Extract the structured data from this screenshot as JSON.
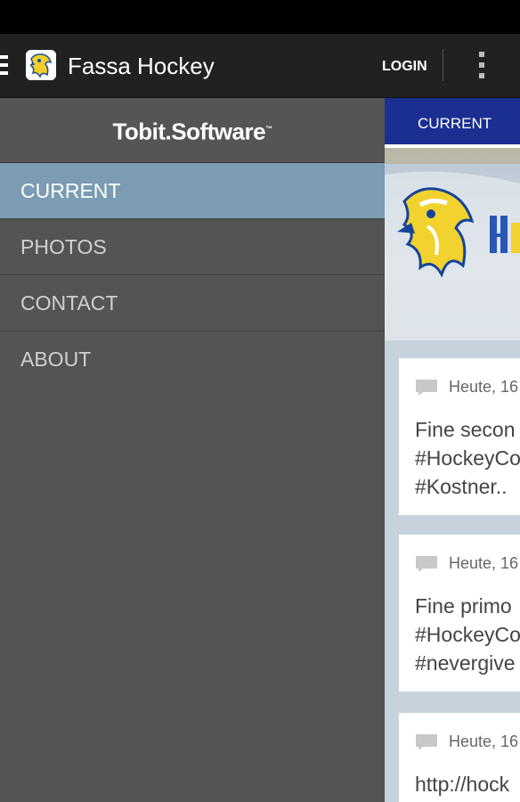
{
  "app": {
    "title": "Fassa Hockey"
  },
  "actionbar": {
    "login_label": "LOGIN",
    "menu_icon": "hamburger-icon",
    "overflow_icon": "overflow-menu-icon",
    "app_icon": "eagle-logo-icon"
  },
  "drawer": {
    "brand": "Tobit.Software",
    "items": [
      {
        "label": "CURRENT",
        "active": true
      },
      {
        "label": "PHOTOS",
        "active": false
      },
      {
        "label": "CONTACT",
        "active": false
      },
      {
        "label": "ABOUT",
        "active": false
      }
    ]
  },
  "content": {
    "tab_label": "CURRENT",
    "posts": [
      {
        "meta": "Heute, 16",
        "lines": [
          "Fine secon",
          "#HockeyCo",
          "#Kostner.."
        ]
      },
      {
        "meta": "Heute, 16",
        "lines": [
          "Fine primo",
          "#HockeyCo",
          "#nevergive"
        ]
      },
      {
        "meta": "Heute, 16",
        "lines": [
          "http://hock"
        ]
      }
    ]
  },
  "colors": {
    "accent_tab": "#1b2f93",
    "active_nav": "#7b9cb3",
    "drawer_bg": "#545454",
    "actionbar_bg": "#212121"
  }
}
